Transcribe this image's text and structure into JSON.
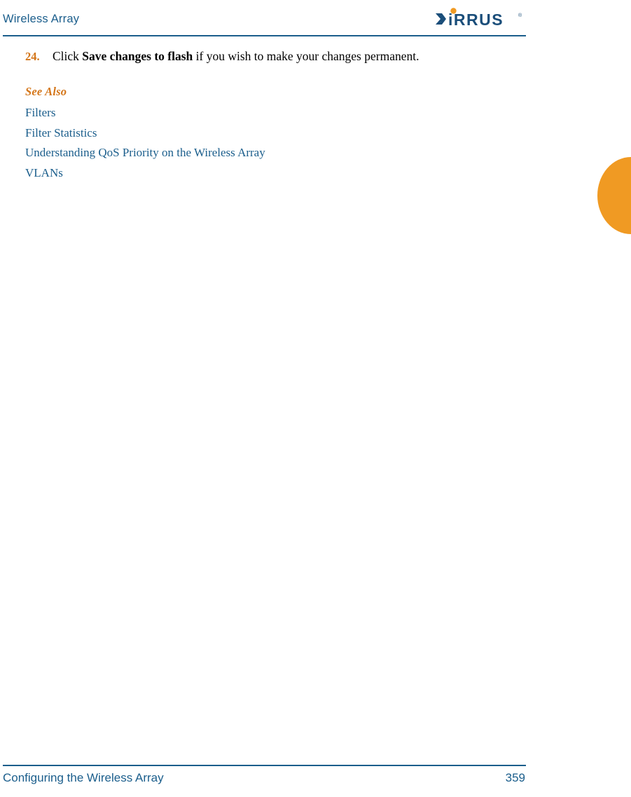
{
  "header": {
    "title": "Wireless Array",
    "logo": {
      "name": "xirrus-logo",
      "wordmark": "XIRRUS",
      "trademark": "®",
      "colors": {
        "text": "#1b4e7a",
        "accent": "#f09a23"
      }
    }
  },
  "body": {
    "step": {
      "number": "24.",
      "text_before": "Click ",
      "bold_text": "Save changes to flash",
      "text_after": " if you wish to make your changes permanent."
    },
    "see_also_heading": "See Also",
    "cross_references": [
      {
        "label": "Filters"
      },
      {
        "label": "Filter Statistics"
      },
      {
        "label": "Understanding QoS Priority on the Wireless Array"
      },
      {
        "label": "VLANs"
      }
    ]
  },
  "footer": {
    "section_title": "Configuring the Wireless Array",
    "page_number": "359"
  },
  "colors": {
    "heading_blue": "#1b5e8c",
    "accent_orange": "#d4761a",
    "tab_orange": "#f09a23"
  }
}
